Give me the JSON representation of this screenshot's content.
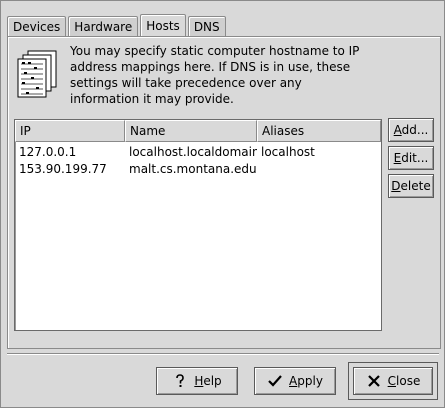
{
  "tabs": [
    {
      "label": "Devices"
    },
    {
      "label": "Hardware"
    },
    {
      "label": "Hosts"
    },
    {
      "label": "DNS"
    }
  ],
  "active_tab": "Hosts",
  "info": {
    "icon": "host-table-icon",
    "text": "You may specify static computer hostname to IP address mappings here. If DNS is in use, these settings will take precedence over any information it may provide."
  },
  "hosts_table": {
    "columns": [
      "IP",
      "Name",
      "Aliases"
    ],
    "rows": [
      {
        "ip": "127.0.0.1",
        "name": "localhost.localdomain",
        "aliases": "localhost"
      },
      {
        "ip": "153.90.199.77",
        "name": "malt.cs.montana.edu",
        "aliases": ""
      }
    ]
  },
  "side_buttons": {
    "add": {
      "first": "A",
      "rest": "dd..."
    },
    "edit": {
      "first": "E",
      "rest": "dit..."
    },
    "delete": {
      "first": "D",
      "rest": "elete"
    }
  },
  "bottom_buttons": {
    "help": {
      "first": "H",
      "rest": "elp",
      "icon": "question-icon"
    },
    "apply": {
      "first": "A",
      "rest": "pply",
      "icon": "checkmark-icon"
    },
    "close": {
      "first": "C",
      "rest": "lose",
      "icon": "x-icon"
    }
  },
  "colors": {
    "window_bg": "#d9d9d9",
    "list_bg": "#ffffff",
    "border": "#8a8a8a"
  }
}
